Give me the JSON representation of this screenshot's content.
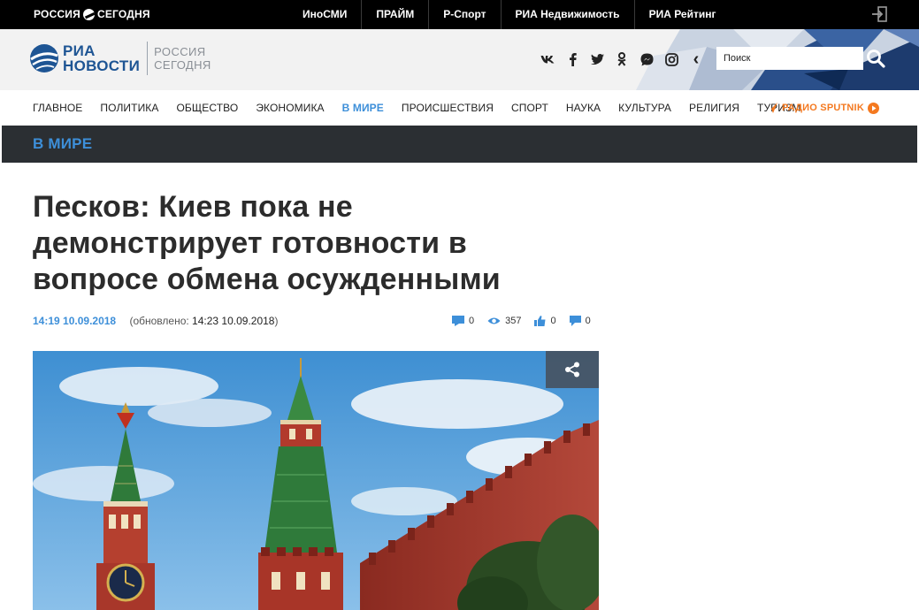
{
  "topbar": {
    "group_logo": {
      "text": "РОССИЯ",
      "text2": "СЕГОДНЯ"
    },
    "partners": [
      "ИноСМИ",
      "ПРАЙМ",
      "Р-Спорт",
      "РИА Недвижимость",
      "РИА Рейтинг"
    ],
    "login_icon": "login-icon"
  },
  "header": {
    "logo": {
      "line1": "РИА",
      "line2": "НОВОСТИ",
      "sub1": "РОССИЯ",
      "sub2": "СЕГОДНЯ"
    },
    "socials": [
      {
        "icon": "vk-icon",
        "glyph": "vk"
      },
      {
        "icon": "facebook-icon",
        "glyph": "f"
      },
      {
        "icon": "twitter-icon",
        "glyph": "t"
      },
      {
        "icon": "odnoklassniki-icon",
        "glyph": "ok"
      },
      {
        "icon": "messenger-icon",
        "glyph": "msg"
      },
      {
        "icon": "instagram-icon",
        "glyph": "ig"
      },
      {
        "icon": "chevron-left-icon",
        "glyph": "‹"
      }
    ],
    "search": {
      "placeholder": "Поиск",
      "icon": "search-icon"
    }
  },
  "nav": {
    "items": [
      {
        "label": "ГЛАВНОЕ",
        "active": false
      },
      {
        "label": "ПОЛИТИКА",
        "active": false
      },
      {
        "label": "ОБЩЕСТВО",
        "active": false
      },
      {
        "label": "ЭКОНОМИКА",
        "active": false
      },
      {
        "label": "В МИРЕ",
        "active": true
      },
      {
        "label": "ПРОИСШЕСТВИЯ",
        "active": false
      },
      {
        "label": "СПОРТ",
        "active": false
      },
      {
        "label": "НАУКА",
        "active": false
      },
      {
        "label": "КУЛЬТУРА",
        "active": false
      },
      {
        "label": "РЕЛИГИЯ",
        "active": false
      },
      {
        "label": "ТУРИЗМ",
        "active": false
      }
    ],
    "radio": {
      "label": "РАДИО SPUTNIK",
      "icon": "sputnik-plane-icon",
      "play_icon": "play-icon"
    }
  },
  "section": {
    "title": "В МИРЕ"
  },
  "article": {
    "headline_lines": [
      "Песков: Киев пока не",
      "демонстрирует готовности в",
      "вопросе обмена осужденными"
    ],
    "time": "14:19",
    "date": "10.09.2018",
    "updated_prefix": "(обновлено: ",
    "updated_value": "14:23 10.09.2018",
    "updated_suffix": ")",
    "counters": {
      "comments": "0",
      "views": "357",
      "likes": "0",
      "dislikes": "0"
    },
    "photo": {
      "icon": "kremlin-photo",
      "share_icon": "share-icon"
    }
  },
  "colors": {
    "accent": "#3d8fd9",
    "brand": "#1e5594",
    "sputnik": "#f47920",
    "band": "#2b2f33"
  }
}
